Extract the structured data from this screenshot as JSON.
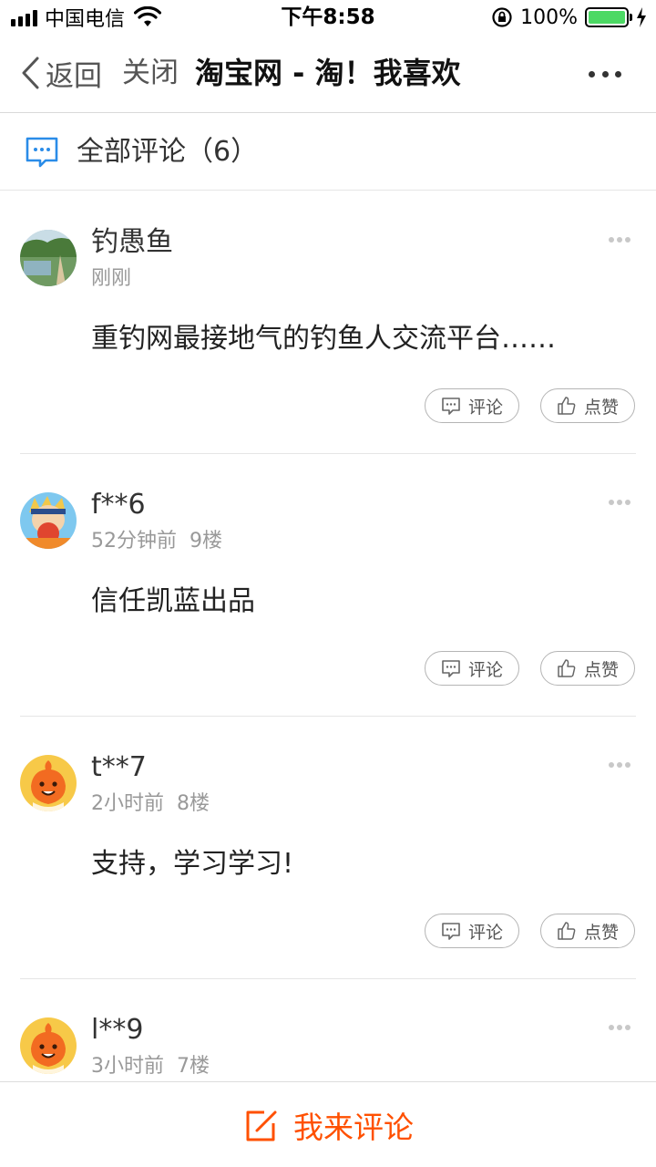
{
  "status_bar": {
    "carrier": "中国电信",
    "time": "下午8:58",
    "battery": "100%",
    "battery_level": 1.0
  },
  "nav": {
    "back_label": "返回",
    "close_label": "关闭",
    "title": "淘宝网 - 淘！我喜欢"
  },
  "comments_header": {
    "label": "全部评论（6）"
  },
  "comments": [
    {
      "user": "钓愚鱼",
      "time": "刚刚",
      "floor": "",
      "text": "重钓网最接地气的钓鱼人交流平台……",
      "avatar": "landscape-photo-avatar"
    },
    {
      "user": "f**6",
      "time": "52分钟前",
      "floor": "9楼",
      "text": "信任凯蓝出品",
      "avatar": "cartoon-character-avatar"
    },
    {
      "user": "t**7",
      "time": "2小时前",
      "floor": "8楼",
      "text": "支持，学习学习!",
      "avatar": "orange-mascot-avatar"
    },
    {
      "user": "l**9",
      "time": "3小时前",
      "floor": "7楼",
      "text": "",
      "avatar": "orange-mascot-avatar"
    }
  ],
  "actions": {
    "comment_label": "评论",
    "like_label": "点赞"
  },
  "bottom_bar": {
    "label": "我来评论"
  },
  "colors": {
    "accent": "#ff5000",
    "header_icon": "#2a8ce8",
    "battery": "#4cd964"
  }
}
